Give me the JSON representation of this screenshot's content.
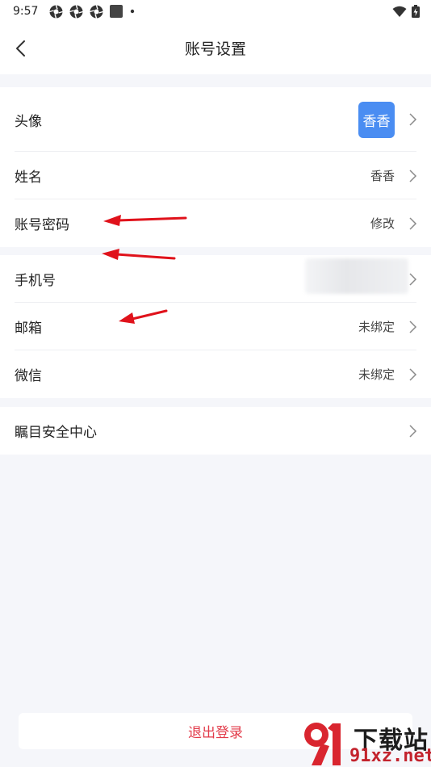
{
  "status_bar": {
    "time": "9:57",
    "icons": [
      "aperture-icon",
      "aperture-icon",
      "aperture-icon",
      "square-icon",
      "dot-icon"
    ],
    "right_icons": [
      "wifi-icon",
      "battery-icon"
    ]
  },
  "nav": {
    "title": "账号设置",
    "back_icon": "chevron-left-icon"
  },
  "sections": {
    "profile": {
      "avatar": {
        "label": "头像",
        "value": "香香",
        "color": "#4a8df2"
      },
      "name": {
        "label": "姓名",
        "value": "香香"
      },
      "password": {
        "label": "账号密码",
        "value": "修改"
      }
    },
    "binding": {
      "phone": {
        "label": "手机号"
      },
      "email": {
        "label": "邮箱",
        "value": "未绑定"
      },
      "wechat": {
        "label": "微信",
        "value": "未绑定"
      }
    },
    "security": {
      "center": {
        "label": "瞩目安全中心"
      }
    }
  },
  "logout": {
    "label": "退出登录",
    "color": "#e23b4a"
  },
  "watermark": {
    "brand": "下载站",
    "url": "91xz.net"
  },
  "colors": {
    "background": "#f5f6fa",
    "annotation_arrow": "#e0121b"
  }
}
